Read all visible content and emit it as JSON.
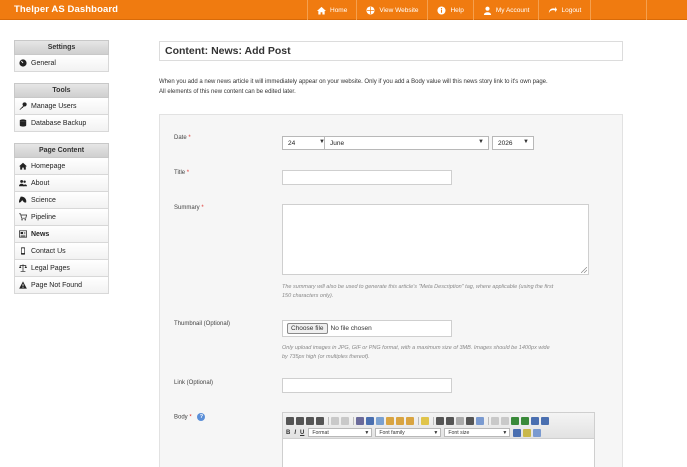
{
  "header": {
    "brand": "Thelper AS Dashboard",
    "nav": [
      {
        "label": "Home",
        "icon": "home-icon"
      },
      {
        "label": "View Website",
        "icon": "globe-icon"
      },
      {
        "label": "Help",
        "icon": "info-icon"
      },
      {
        "label": "My Account",
        "icon": "user-icon"
      },
      {
        "label": "Logout",
        "icon": "logout-icon"
      }
    ]
  },
  "sidebar": {
    "settings_heading": "Settings",
    "settings_items": [
      {
        "label": "General",
        "icon": "gauge-icon"
      }
    ],
    "tools_heading": "Tools",
    "tools_items": [
      {
        "label": "Manage Users",
        "icon": "key-icon"
      },
      {
        "label": "Database Backup",
        "icon": "database-icon"
      }
    ],
    "content_heading": "Page Content",
    "content_items": [
      {
        "label": "Homepage",
        "icon": "home-icon"
      },
      {
        "label": "About",
        "icon": "people-icon"
      },
      {
        "label": "Science",
        "icon": "science-icon"
      },
      {
        "label": "Pipeline",
        "icon": "cart-icon"
      },
      {
        "label": "News",
        "icon": "newspaper-icon",
        "active": true
      },
      {
        "label": "Contact Us",
        "icon": "phone-icon"
      },
      {
        "label": "Legal Pages",
        "icon": "scale-icon"
      },
      {
        "label": "Page Not Found",
        "icon": "warning-icon"
      }
    ]
  },
  "main": {
    "title": "Content: News: Add Post",
    "intro_line1": "When you add a new news article it will immediately appear on your website. Only if you add a Body value will this news story link to it's own page.",
    "intro_line2": "All elements of this new content can be edited later."
  },
  "form": {
    "date_label": "Date",
    "required_mark": "*",
    "day_value": "24",
    "month_value": "June",
    "year_value": "2026",
    "title_label": "Title",
    "summary_label": "Summary",
    "summary_hint_1": "The summary will also be used to generate this article's \"Meta Description\" tag, where applicable (using the first",
    "summary_hint_2": "150 characters only).",
    "thumbnail_label": "Thumbnail (Optional)",
    "file_button": "Choose file",
    "file_status": "No file chosen",
    "thumb_hint_1": "Only upload images in JPG, GIF or PNG format, with a maximum size of 3MB. Images should be 1400px wide",
    "thumb_hint_2": "by 735px high (or multiples thereof).",
    "link_label": "Link (Optional)",
    "body_label": "Body",
    "help_glyph": "?"
  },
  "editor": {
    "bold": "B",
    "italic": "I",
    "underline": "U",
    "format_label": "Format",
    "font_family_label": "Font family",
    "font_size_label": "Font size"
  },
  "colors": {
    "topbar": "#f07b10",
    "required": "#e0322d"
  }
}
